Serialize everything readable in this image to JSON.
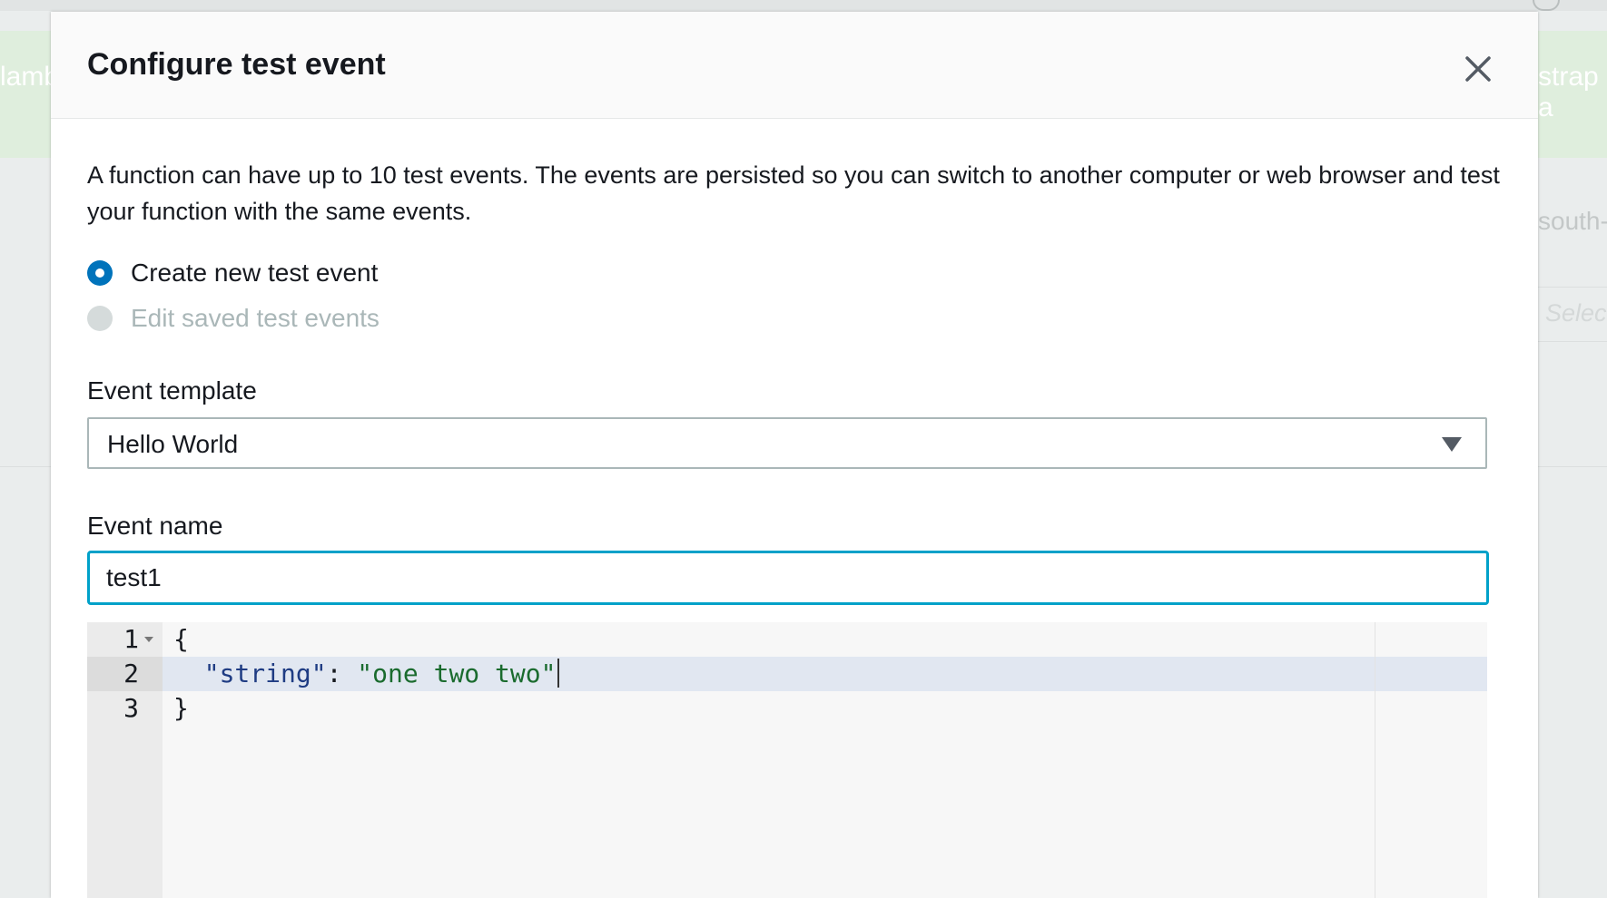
{
  "modal": {
    "title": "Configure test event",
    "description": "A function can have up to 10 test events. The events are persisted so you can switch to another computer or web browser and test your function with the same events.",
    "radio_options": [
      {
        "label": "Create new test event",
        "checked": true,
        "disabled": false
      },
      {
        "label": "Edit saved test events",
        "checked": false,
        "disabled": true
      }
    ],
    "event_template": {
      "label": "Event template",
      "selected": "Hello World"
    },
    "event_name": {
      "label": "Event name",
      "value": "test1"
    },
    "editor": {
      "line_numbers": [
        "1",
        "2",
        "3"
      ],
      "lines": {
        "open_brace": "{",
        "indent": "  ",
        "key": "\"string\"",
        "separator": ": ",
        "value": "\"one two two\"",
        "close_brace": "}"
      }
    }
  },
  "background": {
    "left_fragment": "lamb",
    "right_fragment": "strap a",
    "region_fragment": "south-",
    "select_placeholder_fragment": "Select"
  },
  "colors": {
    "primary": "#0073bb",
    "focus_border": "#00a1c9",
    "header_bg": "#fafafa",
    "disabled_radio": "#d5dbdb",
    "json_key": "#1f3c83",
    "json_string": "#1a6b2e"
  },
  "icons": {
    "close": "close-icon",
    "caret": "caret-down-icon",
    "fold": "fold-arrow-icon"
  }
}
